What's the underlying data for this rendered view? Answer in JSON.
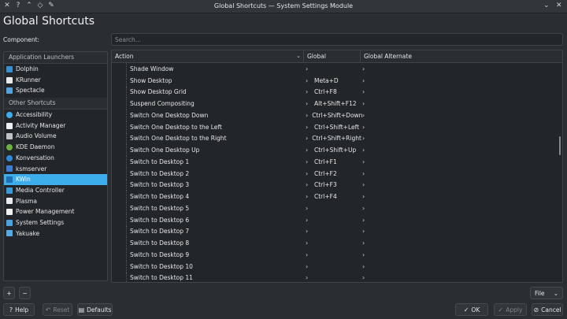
{
  "window": {
    "title": "Global Shortcuts — System Settings Module"
  },
  "page": {
    "title": "Global Shortcuts",
    "component_label": "Component:",
    "search_placeholder": "Search..."
  },
  "components": {
    "sections": [
      {
        "title": "Application Launchers",
        "items": [
          {
            "label": "Dolphin",
            "color": "#3b8ed0"
          },
          {
            "label": "KRunner",
            "color": "#e8eaec"
          },
          {
            "label": "Spectacle",
            "color": "#56a3d9"
          }
        ]
      },
      {
        "title": "Other Shortcuts",
        "items": [
          {
            "label": "Accessibility",
            "color": "#3daee9",
            "round": true
          },
          {
            "label": "Activity Manager",
            "color": "#eef0f1"
          },
          {
            "label": "Audio Volume",
            "color": "#bdc3c7"
          },
          {
            "label": "KDE Daemon",
            "color": "#6cb33f",
            "round": true
          },
          {
            "label": "Konversation",
            "color": "#2e8ad6",
            "round": true
          },
          {
            "label": "ksmserver",
            "color": "#3a7fd3"
          },
          {
            "label": "KWin",
            "color": "#1f6fb5",
            "selected": true
          },
          {
            "label": "Media Controller",
            "color": "#3c9ad8"
          },
          {
            "label": "Plasma",
            "color": "#e8eaec"
          },
          {
            "label": "Power Management",
            "color": "#eef0f1"
          },
          {
            "label": "System Settings",
            "color": "#4aa3df"
          },
          {
            "label": "Yakuake",
            "color": "#5aa9e2"
          }
        ]
      }
    ]
  },
  "table": {
    "columns": [
      "Action",
      "Global",
      "Global Alternate"
    ],
    "rows": [
      {
        "action": "Shade Window",
        "global": "",
        "alternate": ""
      },
      {
        "action": "Show Desktop",
        "global": "Meta+D",
        "alternate": ""
      },
      {
        "action": "Show Desktop Grid",
        "global": "Ctrl+F8",
        "alternate": ""
      },
      {
        "action": "Suspend Compositing",
        "global": "Alt+Shift+F12",
        "alternate": ""
      },
      {
        "action": "Switch One Desktop Down",
        "global": "Ctrl+Shift+Down",
        "alternate": ""
      },
      {
        "action": "Switch One Desktop to the Left",
        "global": "Ctrl+Shift+Left",
        "alternate": ""
      },
      {
        "action": "Switch One Desktop to the Right",
        "global": "Ctrl+Shift+Right",
        "alternate": ""
      },
      {
        "action": "Switch One Desktop Up",
        "global": "Ctrl+Shift+Up",
        "alternate": ""
      },
      {
        "action": "Switch to Desktop 1",
        "global": "Ctrl+F1",
        "alternate": ""
      },
      {
        "action": "Switch to Desktop 2",
        "global": "Ctrl+F2",
        "alternate": ""
      },
      {
        "action": "Switch to Desktop 3",
        "global": "Ctrl+F3",
        "alternate": ""
      },
      {
        "action": "Switch to Desktop 4",
        "global": "Ctrl+F4",
        "alternate": ""
      },
      {
        "action": "Switch to Desktop 5",
        "global": "",
        "alternate": ""
      },
      {
        "action": "Switch to Desktop 6",
        "global": "",
        "alternate": ""
      },
      {
        "action": "Switch to Desktop 7",
        "global": "",
        "alternate": ""
      },
      {
        "action": "Switch to Desktop 8",
        "global": "",
        "alternate": ""
      },
      {
        "action": "Switch to Desktop 9",
        "global": "",
        "alternate": ""
      },
      {
        "action": "Switch to Desktop 10",
        "global": "",
        "alternate": ""
      },
      {
        "action": "Switch to Desktop 11",
        "global": "",
        "alternate": ""
      }
    ]
  },
  "buttons": {
    "add": "+",
    "remove": "−",
    "file": "File",
    "help": "Help",
    "reset": "Reset",
    "defaults": "Defaults",
    "ok": "OK",
    "apply": "Apply",
    "cancel": "Cancel"
  },
  "colors": {
    "accent": "#3daee9",
    "background": "#2a2e32",
    "view": "#232629"
  }
}
